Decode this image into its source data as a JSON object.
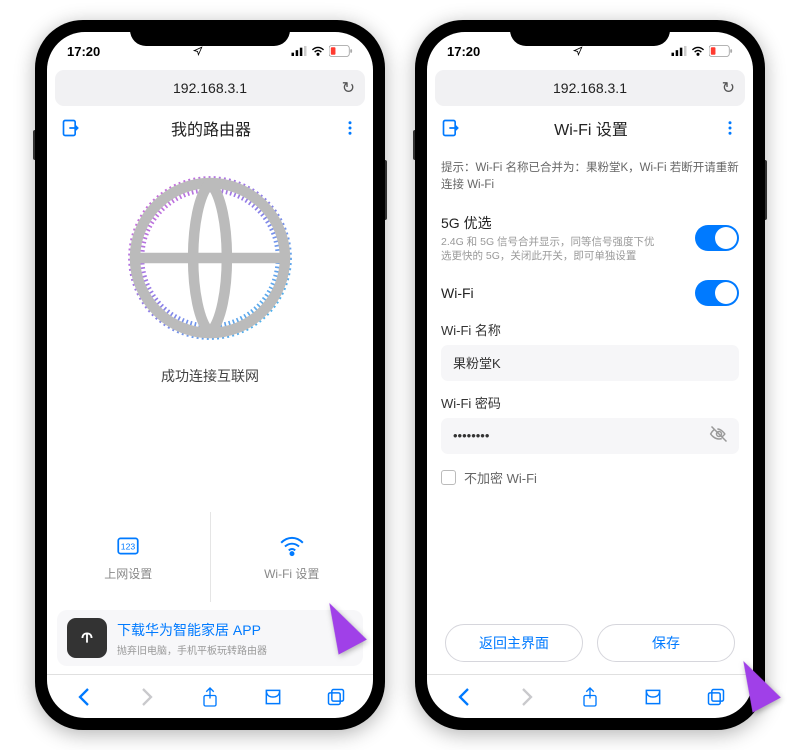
{
  "status": {
    "time": "17:20",
    "battery_low": true
  },
  "url": "192.168.3.1",
  "left": {
    "title": "我的路由器",
    "connected_text": "成功连接互联网",
    "actions": {
      "net": "上网设置",
      "wifi": "Wi-Fi 设置"
    },
    "banner": {
      "title": "下载华为智能家居 APP",
      "subtitle": "抛弃旧电脑，手机平板玩转路由器"
    }
  },
  "right": {
    "title": "Wi-Fi 设置",
    "hint": "提示：Wi-Fi 名称已合并为：果粉堂K，Wi-Fi 若断开请重新连接 Wi-Fi",
    "pref5g": {
      "label": "5G 优选",
      "desc": "2.4G 和 5G 信号合并显示，同等信号强度下优选更快的 5G，关闭此开关，即可单独设置"
    },
    "wifi_label": "Wi-Fi",
    "name": {
      "label": "Wi-Fi 名称",
      "value": "果粉堂K"
    },
    "pwd": {
      "label": "Wi-Fi 密码",
      "value": "••••••••"
    },
    "no_encrypt": "不加密 Wi-Fi",
    "btn_back": "返回主界面",
    "btn_save": "保存"
  }
}
